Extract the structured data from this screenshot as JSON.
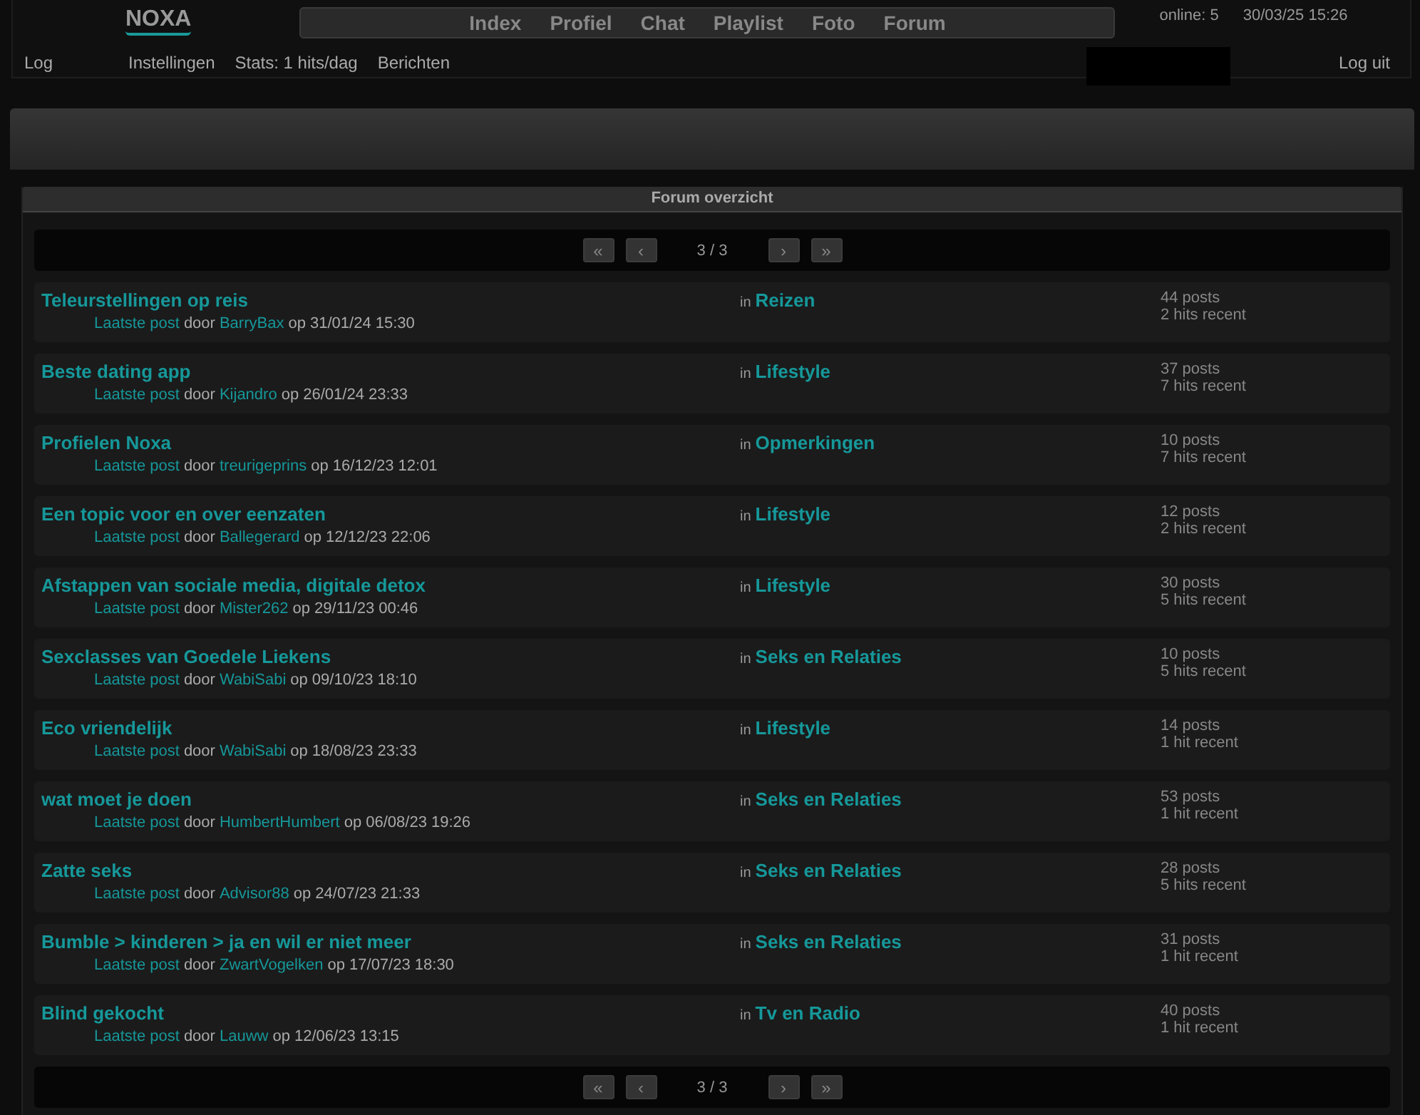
{
  "header": {
    "logo": "NOXA",
    "nav": [
      "Index",
      "Profiel",
      "Chat",
      "Playlist",
      "Foto",
      "Forum"
    ],
    "online": "online: 5",
    "datetime": "30/03/25 15:26",
    "links": [
      "Log",
      "Instellingen",
      "Stats: 1 hits/dag",
      "Berichten"
    ],
    "logout": "Log uit"
  },
  "forum": {
    "title": "Forum overzicht",
    "pager_top": {
      "first": "«",
      "prev": "‹",
      "page": "3 / 3",
      "next": "›",
      "last": "»"
    },
    "topics": [
      {
        "title": "Teleurstellingen op reis",
        "last_post": "Laatste post",
        "by": "door",
        "user": "BarryBax",
        "date": "op 31/01/24 15:30",
        "in": "in",
        "category": "Reizen",
        "posts": "44 posts",
        "hits": "2 hits recent"
      },
      {
        "title": "Beste dating app",
        "last_post": "Laatste post",
        "by": "door",
        "user": "Kijandro",
        "date": "op 26/01/24 23:33",
        "in": "in",
        "category": "Lifestyle",
        "posts": "37 posts",
        "hits": "7 hits recent"
      },
      {
        "title": "Profielen Noxa",
        "last_post": "Laatste post",
        "by": "door",
        "user": "treurigeprins",
        "date": "op 16/12/23 12:01",
        "in": "in",
        "category": "Opmerkingen",
        "posts": "10 posts",
        "hits": "7 hits recent"
      },
      {
        "title": "Een topic voor en over eenzaten",
        "last_post": "Laatste post",
        "by": "door",
        "user": "Ballegerard",
        "date": "op 12/12/23 22:06",
        "in": "in",
        "category": "Lifestyle",
        "posts": "12 posts",
        "hits": "2 hits recent"
      },
      {
        "title": "Afstappen van sociale media, digitale detox",
        "last_post": "Laatste post",
        "by": "door",
        "user": "Mister262",
        "date": "op 29/11/23 00:46",
        "in": "in",
        "category": "Lifestyle",
        "posts": "30 posts",
        "hits": "5 hits recent"
      },
      {
        "title": "Sexclasses van Goedele Liekens",
        "last_post": "Laatste post",
        "by": "door",
        "user": "WabiSabi",
        "date": "op 09/10/23 18:10",
        "in": "in",
        "category": "Seks en Relaties",
        "posts": "10 posts",
        "hits": "5 hits recent"
      },
      {
        "title": "Eco vriendelijk",
        "last_post": "Laatste post",
        "by": "door",
        "user": "WabiSabi",
        "date": "op 18/08/23 23:33",
        "in": "in",
        "category": "Lifestyle",
        "posts": "14 posts",
        "hits": "1 hit recent"
      },
      {
        "title": "wat moet je doen",
        "last_post": "Laatste post",
        "by": "door",
        "user": "HumbertHumbert",
        "date": "op 06/08/23 19:26",
        "in": "in",
        "category": "Seks en Relaties",
        "posts": "53 posts",
        "hits": "1 hit recent"
      },
      {
        "title": "Zatte seks",
        "last_post": "Laatste post",
        "by": "door",
        "user": "Advisor88",
        "date": "op 24/07/23 21:33",
        "in": "in",
        "category": "Seks en Relaties",
        "posts": "28 posts",
        "hits": "5 hits recent"
      },
      {
        "title": "Bumble > kinderen > ja en wil er niet meer",
        "last_post": "Laatste post",
        "by": "door",
        "user": "ZwartVogelken",
        "date": "op 17/07/23 18:30",
        "in": "in",
        "category": "Seks en Relaties",
        "posts": "31 posts",
        "hits": "1 hit recent"
      },
      {
        "title": "Blind gekocht",
        "last_post": "Laatste post",
        "by": "door",
        "user": "Lauww",
        "date": "op 12/06/23 13:15",
        "in": "in",
        "category": "Tv en Radio",
        "posts": "40 posts",
        "hits": "1 hit recent"
      }
    ],
    "pager_bottom": {
      "first": "«",
      "prev": "‹",
      "page": "3 / 3",
      "next": "›",
      "last": "»"
    }
  }
}
